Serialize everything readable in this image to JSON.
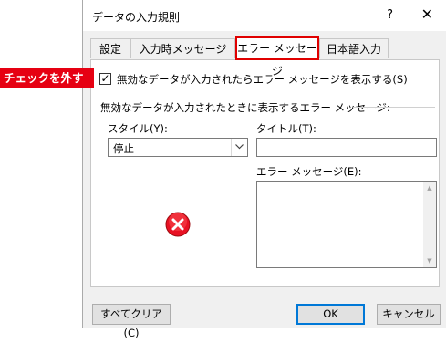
{
  "dialog": {
    "title": "データの入力規則",
    "help": "?",
    "close": "✕"
  },
  "tabs": [
    {
      "label": "設定"
    },
    {
      "label": "入力時メッセージ"
    },
    {
      "label": "エラー メッセージ",
      "active": true
    },
    {
      "label": "日本語入力"
    }
  ],
  "checkbox": {
    "checked": true,
    "mark": "✓",
    "label": "無効なデータが入力されたらエラー メッセージを表示する(S)"
  },
  "section": {
    "label": "無効なデータが入力されたときに表示するエラー メッセージ:"
  },
  "style": {
    "label": "スタイル(Y):",
    "value": "停止"
  },
  "title_field": {
    "label": "タイトル(T):",
    "value": ""
  },
  "message_field": {
    "label": "エラー メッセージ(E):",
    "value": ""
  },
  "icon": {
    "name": "stop-error-icon",
    "color": "#e81123"
  },
  "buttons": {
    "clear_all": "すべてクリア(C)",
    "ok": "OK",
    "cancel": "キャンセル"
  },
  "annotation": {
    "callout": "チェックを外す",
    "color": "#e60012"
  }
}
